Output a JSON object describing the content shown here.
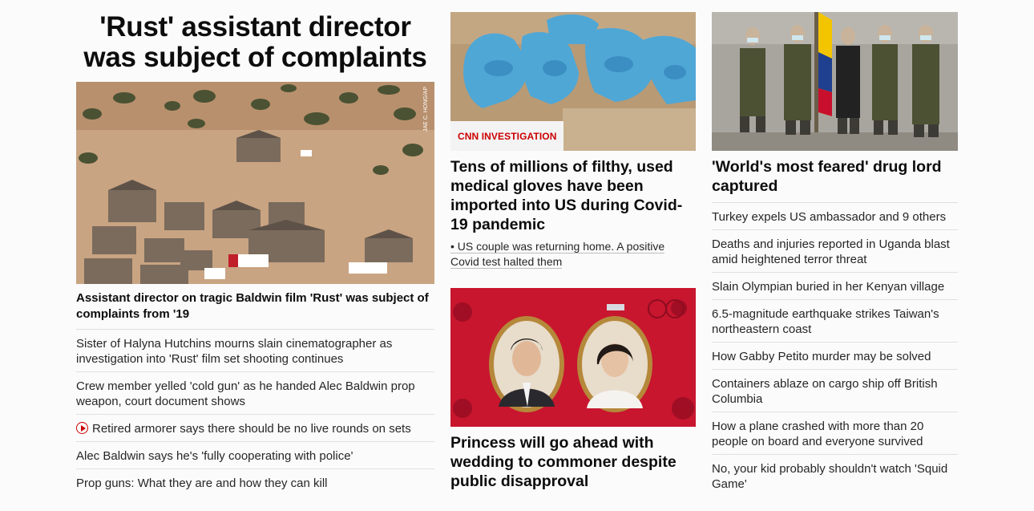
{
  "col1": {
    "headline": "'Rust' assistant director was subject of complaints",
    "photo_credit": "JAE C. HONG/AP",
    "card_headline": "Assistant director on tragic Baldwin film 'Rust' was subject of complaints from '19",
    "links": [
      "Sister of Halyna Hutchins mourns slain cinematographer as investigation into 'Rust' film set shooting continues",
      "Crew member yelled 'cold gun' as he handed Alec Baldwin prop weapon, court document shows",
      "Retired armorer says there should be no live rounds on sets",
      "Alec Baldwin says he's 'fully cooperating with police'",
      "Prop guns: What they are and how they can kill"
    ]
  },
  "col2": {
    "badge": "CNN INVESTIGATION",
    "headline1": "Tens of millions of filthy, used medical gloves have been imported into US during Covid-19 pandemic",
    "bullet": "• US couple was returning home. A positive Covid test halted them",
    "headline2": "Princess will go ahead with wedding to commoner despite public disapproval"
  },
  "col3": {
    "headline": "'World's most feared' drug lord captured",
    "links": [
      "Turkey expels US ambassador and 9 others",
      "Deaths and injuries reported in Uganda blast amid heightened terror threat",
      "Slain Olympian buried in her Kenyan village",
      "6.5-magnitude earthquake strikes Taiwan's northeastern coast",
      "How Gabby Petito murder may be solved",
      "Containers ablaze on cargo ship off British Columbia",
      "How a plane crashed with more than 20 people on board and everyone survived",
      "No, your kid probably shouldn't watch 'Squid Game'"
    ]
  },
  "colors": {
    "accent_red": "#cc0000",
    "divider": "#e0e0e0",
    "text": "#0c0c0c"
  }
}
